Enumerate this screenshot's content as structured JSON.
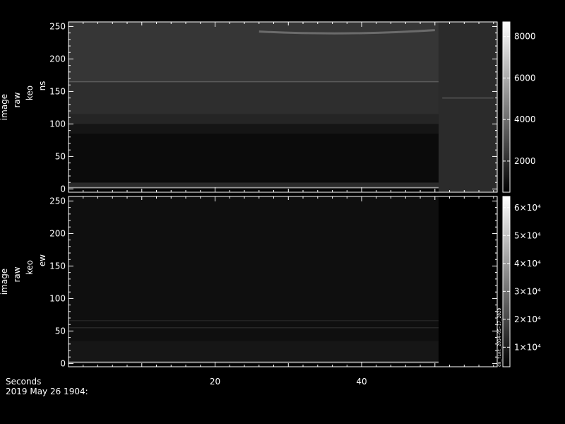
{
  "chart_data": [
    {
      "type": "heatmap",
      "panel": "top",
      "ylabel_lines": [
        "image",
        "raw",
        "keo",
        "ns"
      ],
      "xlim": [
        0,
        58.5
      ],
      "ylim": [
        -5,
        257
      ],
      "x_ticks": [
        20,
        40
      ],
      "y_ticks": [
        0,
        50,
        100,
        150,
        200,
        250
      ],
      "data_end_x": 50.5,
      "colorbar": {
        "range": [
          500,
          8700
        ],
        "ticks": [
          2000,
          4000,
          6000,
          8000
        ],
        "tick_labels": [
          "2000",
          "4000",
          "6000",
          "8000"
        ]
      },
      "bands": [
        {
          "y0": 0,
          "y1": 10,
          "color": "#2a2a2a"
        },
        {
          "y0": 10,
          "y1": 85,
          "color": "#0b0b0b"
        },
        {
          "y0": 85,
          "y1": 100,
          "color": "#151515"
        },
        {
          "y0": 100,
          "y1": 115,
          "color": "#252525"
        },
        {
          "y0": 115,
          "y1": 165,
          "color": "#2e2e2e"
        },
        {
          "y0": 165,
          "y1": 257,
          "color": "#363636"
        }
      ],
      "lines": [
        {
          "y": 2,
          "color": "#9a9a9a"
        },
        {
          "y": 165,
          "color": "#5a5a5a"
        }
      ],
      "after_data_color": "#2b2b2b"
    },
    {
      "type": "heatmap",
      "panel": "bottom",
      "ylabel_lines": [
        "image",
        "raw",
        "keo",
        "ew"
      ],
      "xlim": [
        0,
        58.5
      ],
      "ylim": [
        -5,
        257
      ],
      "x_ticks": [
        20,
        40
      ],
      "y_ticks": [
        0,
        50,
        100,
        150,
        200,
        250
      ],
      "data_end_x": 50.5,
      "colorbar": {
        "range": [
          3000,
          64000
        ],
        "ticks": [
          10000,
          20000,
          30000,
          40000,
          50000,
          60000
        ],
        "tick_labels": [
          "1×10⁴",
          "2×10⁴",
          "3×10⁴",
          "4×10⁴",
          "5×10⁴",
          "6×10⁴"
        ]
      },
      "bands": [
        {
          "y0": 0,
          "y1": 35,
          "color": "#161616"
        },
        {
          "y0": 35,
          "y1": 257,
          "color": "#0f0f0f"
        }
      ],
      "lines": [
        {
          "y": 2,
          "color": "#bdbdbd"
        },
        {
          "y": 55,
          "color": "#262626"
        },
        {
          "y": 66,
          "color": "#222222"
        }
      ],
      "after_data_color": "#000000"
    }
  ],
  "x_axis_label": "Seconds",
  "date_label": "2019 May 26 1904:",
  "colorbar_side_text": "dm_fint_2014-05-17_2020",
  "colorbar_side_text_2": "rbsp-a_rt_bp"
}
